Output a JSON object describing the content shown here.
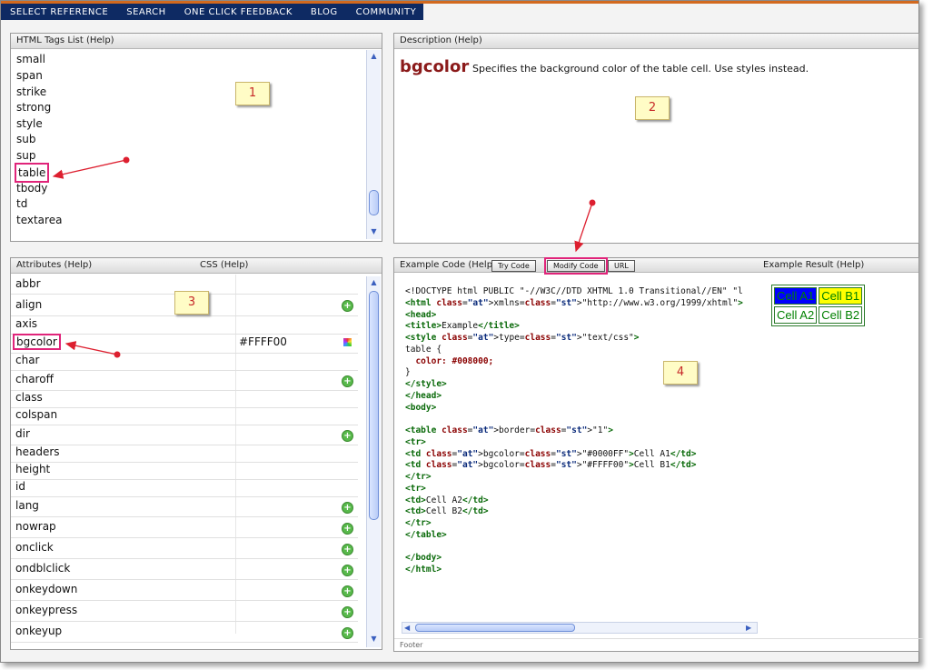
{
  "nav": [
    "SELECT REFERENCE",
    "SEARCH",
    "ONE CLICK FEEDBACK",
    "BLOG",
    "COMMUNITY"
  ],
  "tags_panel": {
    "title": "HTML Tags List (Help)",
    "items": [
      "small",
      "span",
      "strike",
      "strong",
      "style",
      "sub",
      "sup",
      "table",
      "tbody",
      "td",
      "textarea"
    ]
  },
  "description": {
    "title": "Description (Help)",
    "keyword": "bgcolor",
    "text": "Specifies the background color of the table cell. Use styles instead."
  },
  "attributes_panel": {
    "title": "Attributes (Help)",
    "css_label": "CSS (Help)",
    "rows": [
      {
        "name": "abbr",
        "value": "",
        "plus": false
      },
      {
        "name": "align",
        "value": "",
        "plus": true
      },
      {
        "name": "axis",
        "value": "",
        "plus": false
      },
      {
        "name": "bgcolor",
        "value": "#FFFF00",
        "plus": false
      },
      {
        "name": "char",
        "value": "",
        "plus": false
      },
      {
        "name": "charoff",
        "value": "",
        "plus": true
      },
      {
        "name": "class",
        "value": "",
        "plus": false
      },
      {
        "name": "colspan",
        "value": "",
        "plus": false
      },
      {
        "name": "dir",
        "value": "",
        "plus": true
      },
      {
        "name": "headers",
        "value": "",
        "plus": false
      },
      {
        "name": "height",
        "value": "",
        "plus": false
      },
      {
        "name": "id",
        "value": "",
        "plus": false
      },
      {
        "name": "lang",
        "value": "",
        "plus": true
      },
      {
        "name": "nowrap",
        "value": "",
        "plus": true
      },
      {
        "name": "onclick",
        "value": "",
        "plus": true
      },
      {
        "name": "ondblclick",
        "value": "",
        "plus": true
      },
      {
        "name": "onkeydown",
        "value": "",
        "plus": true
      },
      {
        "name": "onkeypress",
        "value": "",
        "plus": true
      },
      {
        "name": "onkeyup",
        "value": "",
        "plus": true
      }
    ]
  },
  "example": {
    "title": "Example Code (Help)",
    "buttons": [
      "Try Code",
      "Modify Code",
      "URL"
    ],
    "result_title": "Example Result (Help)",
    "footer": "Footer"
  },
  "code_lines": [
    "<!DOCTYPE html PUBLIC \"-//W3C//DTD XHTML 1.0 Transitional//EN\" \"l",
    "<html xmlns=\"http://www.w3.org/1999/xhtml\">",
    "<head>",
    "<title>Example</title>",
    "<style type=\"text/css\">",
    "table {",
    "  color: #008000;",
    "}",
    "</style>",
    "</head>",
    "<body>",
    "",
    "<table border=\"1\">",
    "<tr>",
    "<td bgcolor=\"#0000FF\">Cell A1</td>",
    "<td bgcolor=\"#FFFF00\">Cell B1</td>",
    "</tr>",
    "<tr>",
    "<td>Cell A2</td>",
    "<td>Cell B2</td>",
    "</tr>",
    "</table>",
    "",
    "</body>",
    "</html>"
  ],
  "result_table": {
    "a1": "Cell A1",
    "b1": "Cell B1",
    "a2": "Cell A2",
    "b2": "Cell B2",
    "a1_bg": "#0000FF",
    "b1_bg": "#FFFF00",
    "text_color": "#008000"
  },
  "badges": [
    "1",
    "2",
    "3",
    "4"
  ],
  "colors": {
    "nav_bg": "#0e2a63",
    "accent_strip": "#d2691e",
    "highlight": "#e0247a",
    "keyword": "#8b1a1a"
  }
}
